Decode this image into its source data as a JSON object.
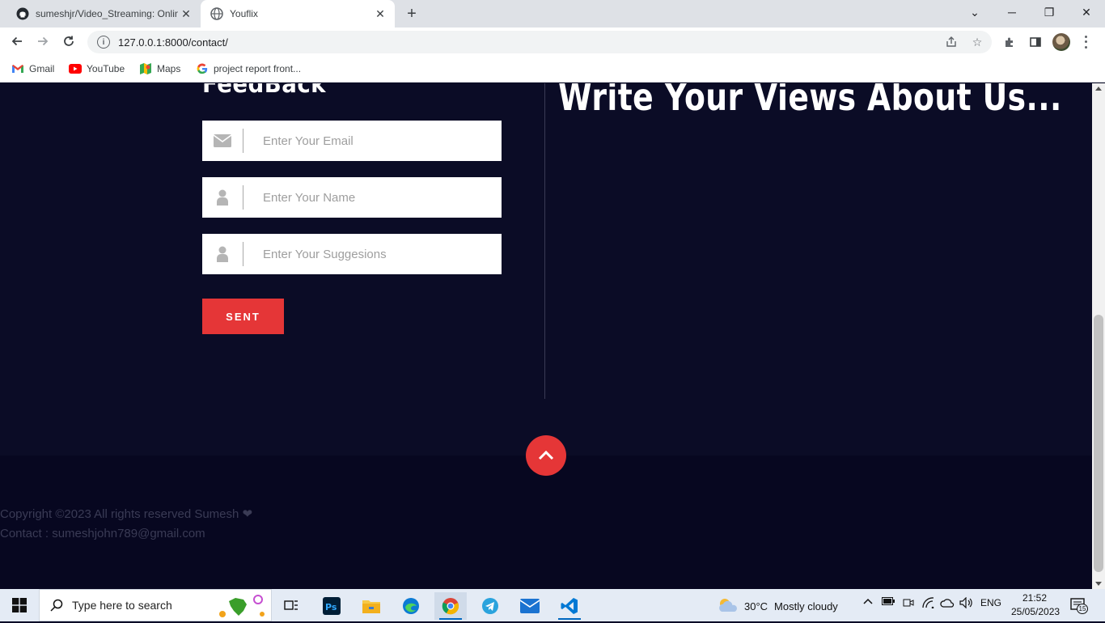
{
  "browser": {
    "tabs": [
      {
        "title": "sumeshjr/Video_Streaming: Onlin",
        "favicon": "github-icon",
        "active": false
      },
      {
        "title": "Youflix",
        "favicon": "globe-icon",
        "active": true
      }
    ],
    "url": "127.0.0.1:8000/contact/",
    "bookmarks": [
      {
        "label": "Gmail",
        "icon": "gmail-icon"
      },
      {
        "label": "YouTube",
        "icon": "youtube-icon"
      },
      {
        "label": "Maps",
        "icon": "maps-icon"
      },
      {
        "label": "project report front...",
        "icon": "google-icon"
      }
    ]
  },
  "page": {
    "left_heading": "FeedBack",
    "right_heading": "Write Your Views About Us...",
    "form": {
      "email_placeholder": "Enter Your Email",
      "name_placeholder": "Enter Your Name",
      "suggestions_placeholder": "Enter Your Suggesions",
      "submit_label": "SENT"
    },
    "footer": {
      "copyright": "Copyright ©2023 All rights reserved Sumesh",
      "contact": "Contact : sumeshjohn789@gmail.com"
    }
  },
  "taskbar": {
    "search_placeholder": "Type here to search",
    "weather": {
      "temp": "30°C",
      "condition": "Mostly cloudy"
    },
    "language": "ENG",
    "time": "21:52",
    "date": "25/05/2023",
    "notification_count": "15"
  },
  "colors": {
    "page_bg": "#0b0c26",
    "footer_bg": "#070720",
    "accent": "#e53637"
  }
}
